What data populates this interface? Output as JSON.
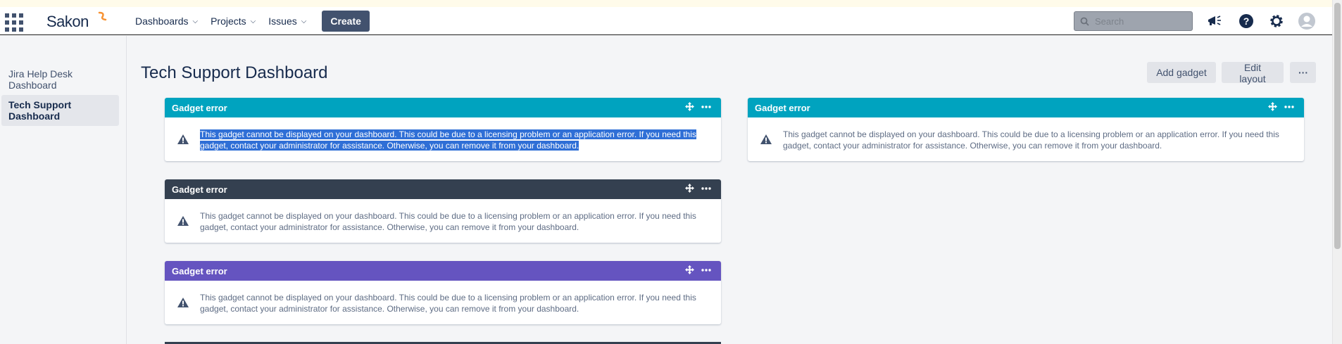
{
  "header": {
    "logo_text": "Sakon",
    "nav": [
      {
        "label": "Dashboards"
      },
      {
        "label": "Projects"
      },
      {
        "label": "Issues"
      }
    ],
    "create_label": "Create",
    "search_placeholder": "Search",
    "icons": [
      "app-switcher-icon",
      "megaphone-icon",
      "help-icon",
      "settings-icon",
      "avatar-icon"
    ]
  },
  "sidebar": {
    "items": [
      {
        "label": "Jira Help Desk Dashboard",
        "active": false
      },
      {
        "label": "Tech Support Dashboard",
        "active": true
      }
    ]
  },
  "main": {
    "title": "Tech Support Dashboard",
    "add_gadget_label": "Add gadget",
    "edit_layout_label": "Edit layout",
    "more_label": "···"
  },
  "gadgets": [
    {
      "title": "Gadget error",
      "color": "#00a3bf",
      "message": "This gadget cannot be displayed on your dashboard. This could be due to a licensing problem or an application error. If you need this gadget, contact your administrator for assistance. Otherwise, you can remove it from your dashboard.",
      "selected": true
    },
    {
      "title": "Gadget error",
      "color": "#344050",
      "message": "This gadget cannot be displayed on your dashboard. This could be due to a licensing problem or an application error. If you need this gadget, contact your administrator for assistance. Otherwise, you can remove it from your dashboard.",
      "selected": false
    },
    {
      "title": "Gadget error",
      "color": "#6554c0",
      "message": "This gadget cannot be displayed on your dashboard. This could be due to a licensing problem or an application error. If you need this gadget, contact your administrator for assistance. Otherwise, you can remove it from your dashboard.",
      "selected": false
    },
    {
      "title": "Gadget error",
      "color": "#00a3bf",
      "message": "This gadget cannot be displayed on your dashboard. This could be due to a licensing problem or an application error. If you need this gadget, contact your administrator for assistance. Otherwise, you can remove it from your dashboard.",
      "selected": false
    }
  ]
}
